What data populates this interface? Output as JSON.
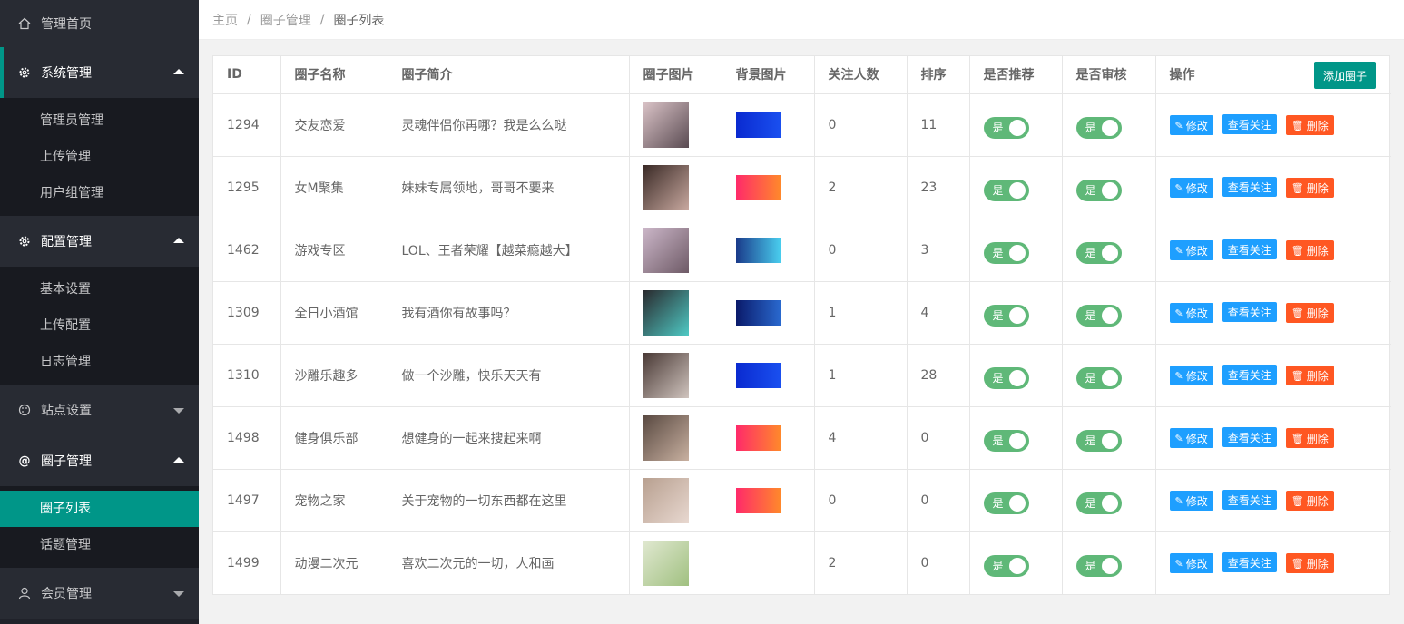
{
  "sidebar": {
    "home": "管理首页",
    "groups": [
      {
        "label": "系统管理",
        "items": [
          "管理员管理",
          "上传管理",
          "用户组管理"
        ]
      },
      {
        "label": "配置管理",
        "items": [
          "基本设置",
          "上传配置",
          "日志管理"
        ]
      },
      {
        "label": "站点设置"
      },
      {
        "label": "圈子管理",
        "items": [
          "圈子列表",
          "话题管理"
        ]
      },
      {
        "label": "会员管理"
      }
    ]
  },
  "breadcrumb": {
    "home": "主页",
    "level1": "圈子管理",
    "level2": "圈子列表"
  },
  "table": {
    "headers": [
      "ID",
      "圈子名称",
      "圈子简介",
      "圈子图片",
      "背景图片",
      "关注人数",
      "排序",
      "是否推荐",
      "是否审核",
      "操作"
    ],
    "add_button": "添加圈子",
    "toggle_label": "是",
    "actions": {
      "edit": "修改",
      "view": "查看关注",
      "delete": "删除"
    },
    "rows": [
      {
        "id": "1294",
        "name": "交友恋爱",
        "desc": "灵魂伴侣你再哪？我是么么哒",
        "followers": "0",
        "sort": "11"
      },
      {
        "id": "1295",
        "name": "女M聚集",
        "desc": "妹妹专属领地，哥哥不要来",
        "followers": "2",
        "sort": "23"
      },
      {
        "id": "1462",
        "name": "游戏专区",
        "desc": "LOL、王者荣耀【越菜瘾越大】",
        "followers": "0",
        "sort": "3"
      },
      {
        "id": "1309",
        "name": "全日小酒馆",
        "desc": "我有酒你有故事吗？",
        "followers": "1",
        "sort": "4"
      },
      {
        "id": "1310",
        "name": "沙雕乐趣多",
        "desc": "做一个沙雕，快乐天天有",
        "followers": "1",
        "sort": "28"
      },
      {
        "id": "1498",
        "name": "健身俱乐部",
        "desc": "想健身的一起来搜起来啊",
        "followers": "4",
        "sort": "0"
      },
      {
        "id": "1497",
        "name": "宠物之家",
        "desc": "关于宠物的一切东西都在这里",
        "followers": "0",
        "sort": "0"
      },
      {
        "id": "1499",
        "name": "动漫二次元",
        "desc": "喜欢二次元的一切，人和画",
        "followers": "2",
        "sort": "0"
      }
    ]
  }
}
